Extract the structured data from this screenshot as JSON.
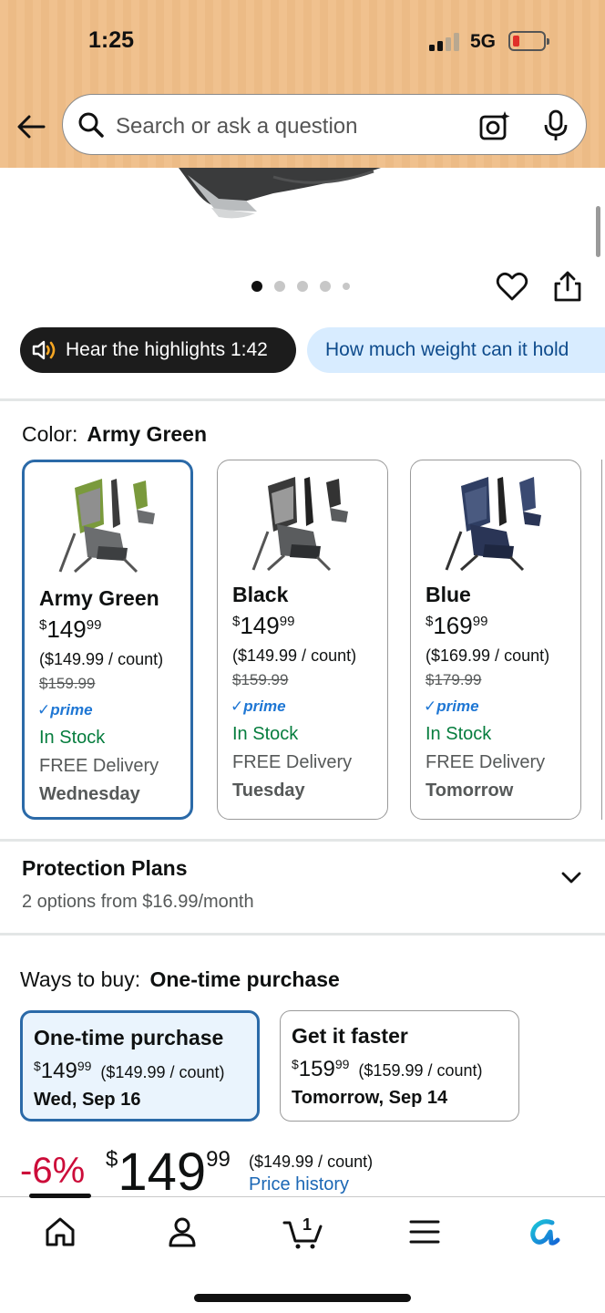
{
  "status_bar": {
    "time": "1:25",
    "network": "5G"
  },
  "search": {
    "placeholder": "Search or ask a question"
  },
  "carousel": {
    "total_images": 5,
    "active_index": 0
  },
  "chips": {
    "hear": "Hear the highlights 1:42",
    "ask": "How much weight can it hold"
  },
  "color": {
    "label": "Color:",
    "selected": "Army Green",
    "variants": [
      {
        "name": "Army Green",
        "price_dollars": "149",
        "price_cents": "99",
        "currency": "$",
        "unit_price": "($149.99 / count)",
        "was": "$159.99",
        "prime": "prime",
        "stock": "In Stock",
        "delivery": "FREE Delivery",
        "day": "Wednesday",
        "selected": true
      },
      {
        "name": "Black",
        "price_dollars": "149",
        "price_cents": "99",
        "currency": "$",
        "unit_price": "($149.99 / count)",
        "was": "$159.99",
        "prime": "prime",
        "stock": "In Stock",
        "delivery": "FREE Delivery",
        "day": "Tuesday",
        "selected": false
      },
      {
        "name": "Blue",
        "price_dollars": "169",
        "price_cents": "99",
        "currency": "$",
        "unit_price": "($169.99 / count)",
        "was": "$179.99",
        "prime": "prime",
        "stock": "In Stock",
        "delivery": "FREE Delivery",
        "day": "Tomorrow",
        "selected": false
      }
    ]
  },
  "protection": {
    "title": "Protection Plans",
    "subtitle": "2 options from $16.99/month"
  },
  "ways_to_buy": {
    "label": "Ways to buy:",
    "selected": "One-time purchase",
    "options": [
      {
        "title": "One-time purchase",
        "currency": "$",
        "price_dollars": "149",
        "price_cents": "99",
        "unit_price": "($149.99 / count)",
        "date": "Wed, Sep 16",
        "selected": true
      },
      {
        "title": "Get it faster",
        "currency": "$",
        "price_dollars": "159",
        "price_cents": "99",
        "unit_price": "($159.99 / count)",
        "date": "Tomorrow, Sep 14",
        "selected": false
      }
    ]
  },
  "price": {
    "discount": "-6%",
    "currency": "$",
    "dollars": "149",
    "cents": "99",
    "unit_price": "($149.99 / count)",
    "history_link": "Price history"
  },
  "cart": {
    "count": "1"
  },
  "colors": {
    "header_bg": "#f0c18e",
    "selected_border": "#2b6aa8",
    "in_stock": "#067d3e",
    "prime": "#1f77d4",
    "discount": "#cc0c39",
    "link": "#1b67b5",
    "ask_chip_bg": "#d8ecff"
  }
}
